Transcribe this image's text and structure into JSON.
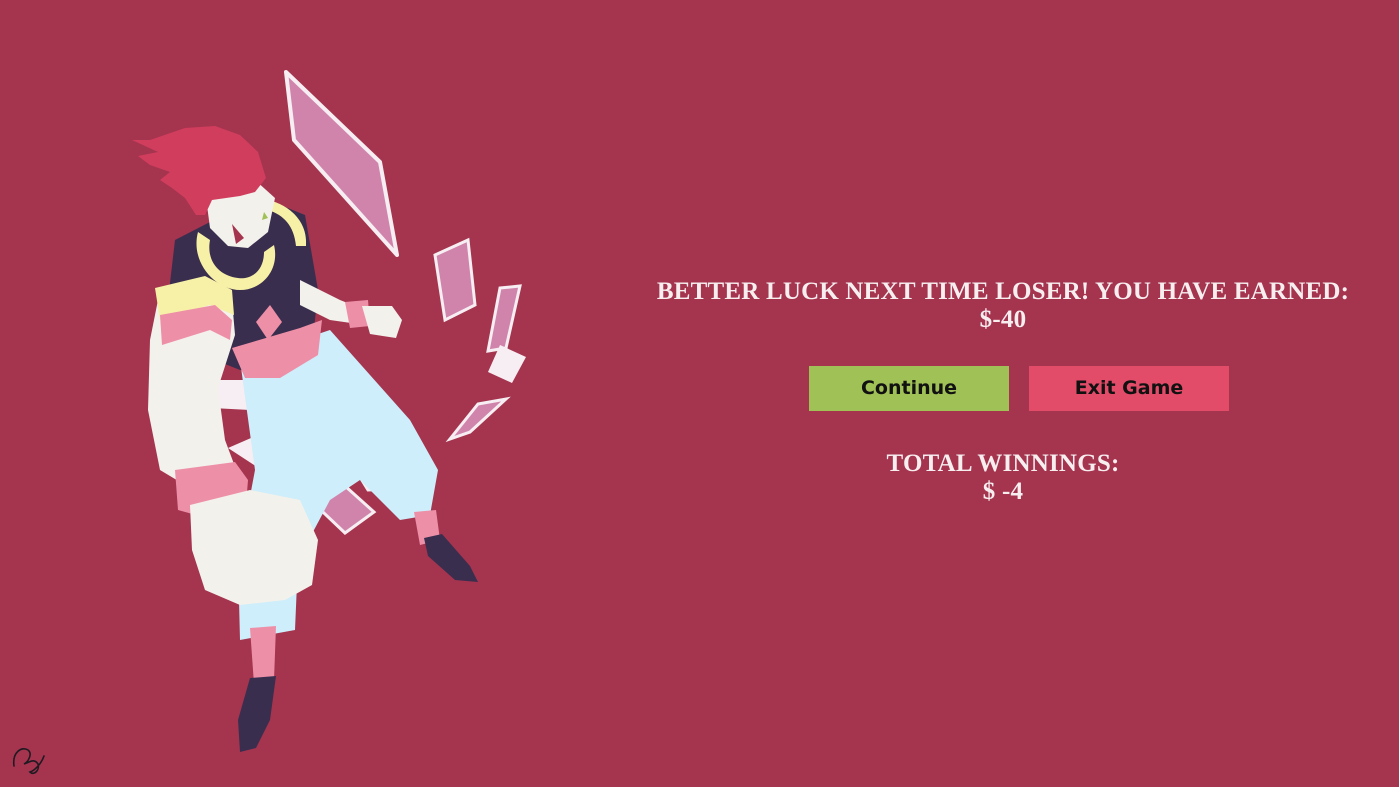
{
  "colors": {
    "background": "#a5344f",
    "text": "#f7eef0",
    "continue_button": "#9fc155",
    "exit_button": "#e24c69"
  },
  "result": {
    "message": "BETTER LUCK NEXT TIME LOSER! YOU HAVE EARNED:",
    "amount": "$-40"
  },
  "buttons": {
    "continue_label": "Continue",
    "exit_label": "Exit Game"
  },
  "totals": {
    "label": "TOTAL WINNINGS:",
    "amount": "$ -4"
  },
  "illustration": {
    "subject": "card-throwing-character-icon",
    "signature": "artist-signature-icon"
  }
}
